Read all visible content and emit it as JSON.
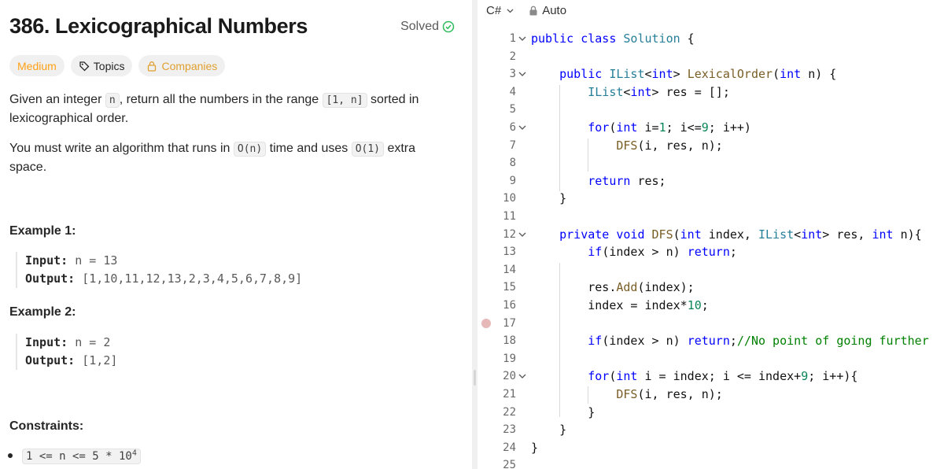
{
  "problem": {
    "title": "386. Lexicographical Numbers",
    "status": "Solved",
    "tags": [
      "Medium",
      "Topics",
      "Companies"
    ],
    "desc1_pre": "Given an integer ",
    "desc1_code1": "n",
    "desc1_mid": ", return all the numbers in the range ",
    "desc1_code2": "[1, n]",
    "desc1_post": " sorted in lexicographical order.",
    "desc2_pre": "You must write an algorithm that runs in ",
    "desc2_code1": "O(n)",
    "desc2_mid": " time and uses ",
    "desc2_code2": "O(1)",
    "desc2_post": " extra space.",
    "examples": [
      {
        "title": "Example 1:",
        "input_label": "Input:",
        "input": " n = 13",
        "output_label": "Output:",
        "output": " [1,10,11,12,13,2,3,4,5,6,7,8,9]"
      },
      {
        "title": "Example 2:",
        "input_label": "Input:",
        "input": " n = 2",
        "output_label": "Output:",
        "output": " [1,2]"
      }
    ],
    "constraints_title": "Constraints:",
    "constraint_text": "1 <= n <= 5 * 10",
    "constraint_sup": "4"
  },
  "editor": {
    "language": "C#",
    "mode": "Auto",
    "lines": [
      {
        "n": "1",
        "fold": true,
        "html": "<span class='kw'>public</span> <span class='kw'>class</span> <span class='ty'>Solution</span> {"
      },
      {
        "n": "2",
        "fold": false,
        "html": ""
      },
      {
        "n": "3",
        "fold": true,
        "html": "    <span class='kw'>public</span> <span class='ty'>IList</span>&lt;<span class='kw'>int</span>&gt; <span class='fn'>LexicalOrder</span>(<span class='kw'>int</span> n) {"
      },
      {
        "n": "4",
        "fold": false,
        "html": "        <span class='ty'>IList</span>&lt;<span class='kw'>int</span>&gt; res = [];"
      },
      {
        "n": "5",
        "fold": false,
        "html": ""
      },
      {
        "n": "6",
        "fold": true,
        "html": "        <span class='kw'>for</span>(<span class='kw'>int</span> i=<span class='nm'>1</span>; i&lt;=<span class='nm'>9</span>; i++)"
      },
      {
        "n": "7",
        "fold": false,
        "html": "            <span class='fn'>DFS</span>(i, res, n);"
      },
      {
        "n": "8",
        "fold": false,
        "html": ""
      },
      {
        "n": "9",
        "fold": false,
        "html": "        <span class='kw'>return</span> res;"
      },
      {
        "n": "10",
        "fold": false,
        "html": "    }"
      },
      {
        "n": "11",
        "fold": false,
        "html": ""
      },
      {
        "n": "12",
        "fold": true,
        "html": "    <span class='kw'>private</span> <span class='kw'>void</span> <span class='fn'>DFS</span>(<span class='kw'>int</span> index, <span class='ty'>IList</span>&lt;<span class='kw'>int</span>&gt; res, <span class='kw'>int</span> n){"
      },
      {
        "n": "13",
        "fold": false,
        "html": "        <span class='kw'>if</span>(index &gt; n) <span class='kw'>return</span>;"
      },
      {
        "n": "14",
        "fold": false,
        "html": ""
      },
      {
        "n": "15",
        "fold": false,
        "html": "        res.<span class='fn'>Add</span>(index);"
      },
      {
        "n": "16",
        "fold": false,
        "html": "        index = index*<span class='nm'>10</span>;"
      },
      {
        "n": "17",
        "fold": false,
        "html": ""
      },
      {
        "n": "18",
        "fold": false,
        "html": "        <span class='kw'>if</span>(index &gt; n) <span class='kw'>return</span>;<span class='cm'>//No point of going further</span>"
      },
      {
        "n": "19",
        "fold": false,
        "html": ""
      },
      {
        "n": "20",
        "fold": true,
        "html": "        <span class='kw'>for</span>(<span class='kw'>int</span> i = index; i &lt;= index+<span class='nm'>9</span>; i++){"
      },
      {
        "n": "21",
        "fold": false,
        "html": "            <span class='fn'>DFS</span>(i, res, n);"
      },
      {
        "n": "22",
        "fold": false,
        "html": "        }"
      },
      {
        "n": "23",
        "fold": false,
        "html": "    }"
      },
      {
        "n": "24",
        "fold": false,
        "html": "}"
      },
      {
        "n": "25",
        "fold": false,
        "html": ""
      }
    ]
  }
}
